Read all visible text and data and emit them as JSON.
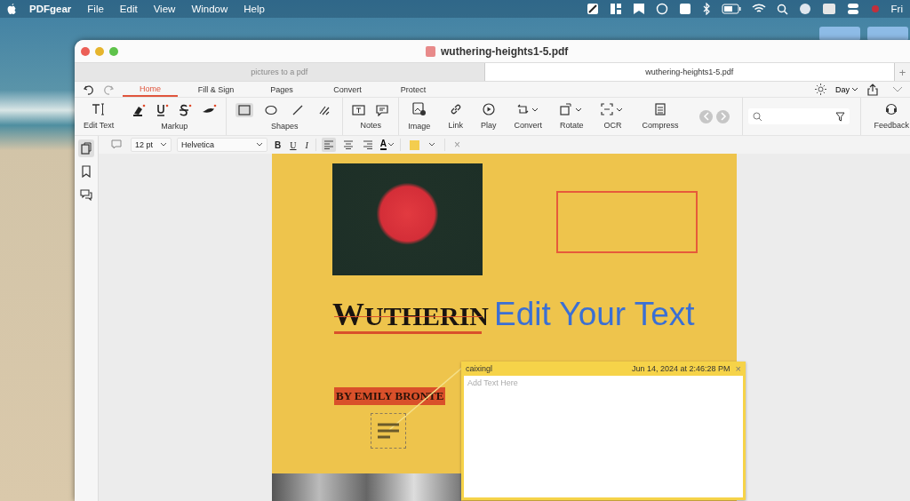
{
  "menu_bar": {
    "app": "PDFgear",
    "menus": [
      "File",
      "Edit",
      "View",
      "Window",
      "Help"
    ],
    "clock": "Fri"
  },
  "window": {
    "title": "wuthering-heights1-5.pdf"
  },
  "doc_tabs": [
    {
      "label": "pictures to a pdf",
      "selected": false
    },
    {
      "label": "wuthering-heights1-5.pdf",
      "selected": true
    }
  ],
  "new_tab": "+",
  "ribbon_tabs": [
    {
      "label": "Home",
      "selected": true
    },
    {
      "label": "Fill & Sign",
      "selected": false
    },
    {
      "label": "Pages",
      "selected": false
    },
    {
      "label": "Convert",
      "selected": false
    },
    {
      "label": "Protect",
      "selected": false
    }
  ],
  "theme_mode": "Day",
  "tools": [
    {
      "kind": "edit-text",
      "label": "Edit Text"
    },
    {
      "kind": "markup",
      "label": "Markup"
    },
    {
      "kind": "shapes",
      "label": "Shapes",
      "items": [
        {
          "selected": true
        },
        {
          "selected": false
        },
        {
          "selected": false
        },
        {
          "selected": false
        }
      ]
    },
    {
      "kind": "notes",
      "label": "Notes"
    },
    {
      "kind": "image",
      "label": "Image"
    },
    {
      "kind": "link",
      "label": "Link"
    },
    {
      "kind": "play",
      "label": "Play"
    },
    {
      "kind": "convert",
      "label": "Convert"
    },
    {
      "kind": "rotate",
      "label": "Rotate"
    },
    {
      "kind": "ocr",
      "label": "OCR"
    },
    {
      "kind": "compress",
      "label": "Compress"
    }
  ],
  "feedback": "Feedback",
  "format_bar": {
    "font_size": "12 pt",
    "font": "Helvetica",
    "styles": [
      "B",
      "U",
      "I"
    ],
    "alignments": [
      {
        "selected": true
      },
      {
        "selected": false
      },
      {
        "selected": false
      }
    ],
    "text_color": "A",
    "close": "×"
  },
  "sidebar": [
    {
      "selected": true
    },
    {
      "selected": false
    },
    {
      "selected": false
    }
  ],
  "page": {
    "title": "WUTHERIN",
    "edit_text": "Edit Your Text",
    "author": "BY EMILY BRONTE"
  },
  "note": {
    "author": "caixingl",
    "date": "Jun 14, 2024 at 2:46:28 PM",
    "close": "×",
    "placeholder": "Add Text Here"
  }
}
